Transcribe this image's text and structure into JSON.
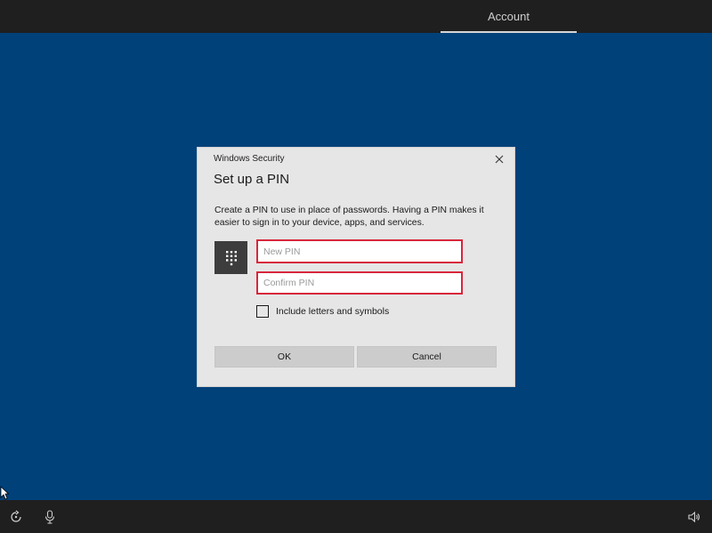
{
  "top_bar": {
    "active_tab": "Account"
  },
  "dialog": {
    "caption": "Windows Security",
    "title": "Set up a PIN",
    "description": "Create a PIN to use in place of passwords. Having a PIN makes it easier to sign in to your device, apps, and services.",
    "new_pin": {
      "value": "",
      "placeholder": "New PIN"
    },
    "confirm_pin": {
      "value": "",
      "placeholder": "Confirm PIN"
    },
    "include_letters_label": "Include letters and symbols",
    "include_letters_checked": false,
    "ok_label": "OK",
    "cancel_label": "Cancel",
    "close_icon": "close-icon",
    "keypad_icon": "keypad-icon"
  },
  "bottom_bar": {
    "icons": [
      "ease-of-access-icon",
      "microphone-icon",
      "volume-icon"
    ]
  },
  "colors": {
    "desktop_background": "#00417a",
    "bar_background": "#1f1f1f",
    "dialog_background": "#e6e6e6",
    "field_highlight": "#d8263c",
    "button_background": "#cccccc"
  }
}
